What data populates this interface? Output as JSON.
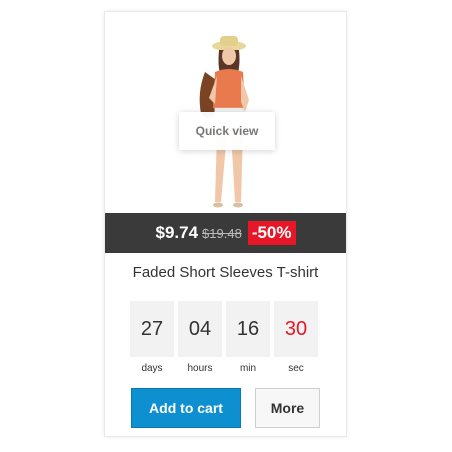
{
  "product": {
    "quick_view_label": "Quick view",
    "price": "$9.74",
    "old_price": "$19.48",
    "discount": "-50%",
    "name": "Faded Short Sleeves T-shirt",
    "countdown": [
      {
        "value": "27",
        "label": "days"
      },
      {
        "value": "04",
        "label": "hours"
      },
      {
        "value": "16",
        "label": "min"
      },
      {
        "value": "30",
        "label": "sec"
      }
    ],
    "add_to_cart_label": "Add to cart",
    "more_label": "More"
  },
  "colors": {
    "price_bar": "#3a3a3a",
    "discount_badge": "#e81727",
    "add_to_cart": "#0e8fcf",
    "countdown_seconds": "#e81727"
  }
}
